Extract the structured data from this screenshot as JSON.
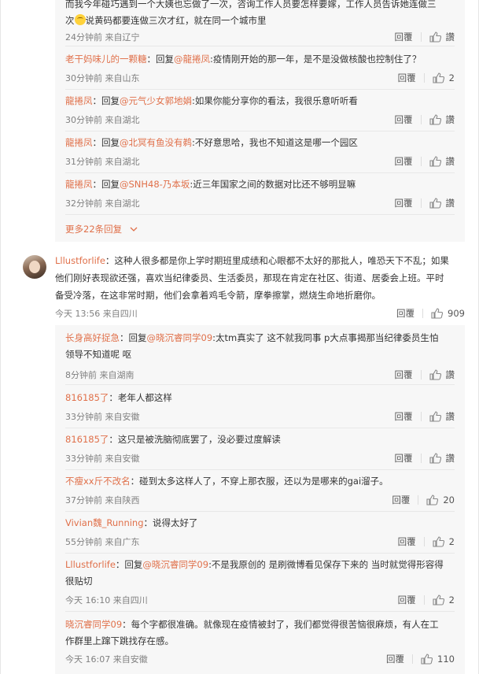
{
  "actions": {
    "reply_label": "回覆",
    "like_label": "讚"
  },
  "first_thread": {
    "top_reply": {
      "text_line1": "而我今年碰巧遇到一个大姨也忘做了一次，咨询工作人员要怎样要嫁，工作人员告诉她连做三",
      "text_line2_pre": "次",
      "text_line2_post": "说黄码都要连做三次才红，就在同一个城市里",
      "meta": "24分钟前 来自辽宁",
      "likes": ""
    },
    "replies": [
      {
        "user": "老干妈味儿的一颗糖",
        "reply_word": "回复",
        "at": "@龍捲凤",
        "text": ":疫情刚开始的那一年，是不是没做核酸也控制住了？",
        "meta": "30分钟前 来自山东",
        "likes": "2"
      },
      {
        "user": "龍捲凤",
        "reply_word": "回复",
        "at": "@元气少女郭地娟",
        "text": ":如果你能分享你的看法，我很乐意听听看",
        "meta": "30分钟前 来自湖北",
        "likes": ""
      },
      {
        "user": "龍捲凤",
        "reply_word": "回复",
        "at": "@北冥有鱼没有鹈",
        "text": ":不好意思哈，我也不知道这是哪一个园区",
        "meta": "31分钟前 来自湖北",
        "likes": ""
      },
      {
        "user": "龍捲凤",
        "reply_word": "回复",
        "at": "@SNH48-乃本坂",
        "text": ":近三年国家之间的数据对比还不够明显嘛",
        "meta": "32分钟前 来自湖北",
        "likes": ""
      }
    ],
    "more_label": "更多22条回复"
  },
  "main_comment": {
    "user": "Lllustforlife",
    "text_line1": "：这种人很多都是你上学时期班里成绩和心眼都不太好的那批人，唯恐天下不乱；如果",
    "text_line2": "他们刚好表现欲还强，喜欢当纪律委员、生活委员，那现在肯定在社区、街道、居委会上班。平时",
    "text_line3": "备受冷落，在这非常时期，他们会拿着鸡毛令箭，摩拳擦掌，燃烧生命地折磨你。",
    "meta": "今天 13:56 来自四川",
    "likes": "909"
  },
  "second_thread": {
    "replies": [
      {
        "user": "长身高好捉急",
        "reply_word": "回复",
        "at": "@晓沉睿同学09",
        "text_line1": ":太tm真实了 这不就我同事 p大点事揭那当纪律委员生怕",
        "text_line2": "领导不知道呢 呕",
        "meta": "8分钟前 来自湖南",
        "likes": ""
      },
      {
        "user": "816185了",
        "text": "：老年人都这样",
        "meta": "33分钟前 来自安徽",
        "likes": ""
      },
      {
        "user": "816185了",
        "text": "：这只是被洗脑彻底罢了，没必要过度解读",
        "meta": "33分钟前 来自安徽",
        "likes": ""
      },
      {
        "user": "不瘦xx斤不改名",
        "text": "：碰到太多这样人了，不穿上那衣服，还以为是哪来的gai溜子。",
        "meta": "37分钟前 来自陕西",
        "likes": "20"
      },
      {
        "user": "Vivian魏_Running",
        "text": "：说得太好了",
        "meta": "55分钟前 来自广东",
        "likes": "2"
      },
      {
        "user": "Lllustforlife",
        "reply_word": "回复",
        "at": "@晓沉睿同学09",
        "text_line1": ":不是我原创的 是刷微博看见保存下来的 当时就觉得形容得",
        "text_line2": "很贴切",
        "meta": "今天 16:10 来自四川",
        "likes": "2"
      },
      {
        "user": "晓沉睿同学09",
        "text_line1": "：每个字都很准确。就像现在疫情被封了，我们都觉得很苦恼很麻烦，有人在工",
        "text_line2": "作群里上蹿下跳找存在感。",
        "meta": "今天 16:07 来自安徽",
        "likes": "110"
      }
    ]
  }
}
